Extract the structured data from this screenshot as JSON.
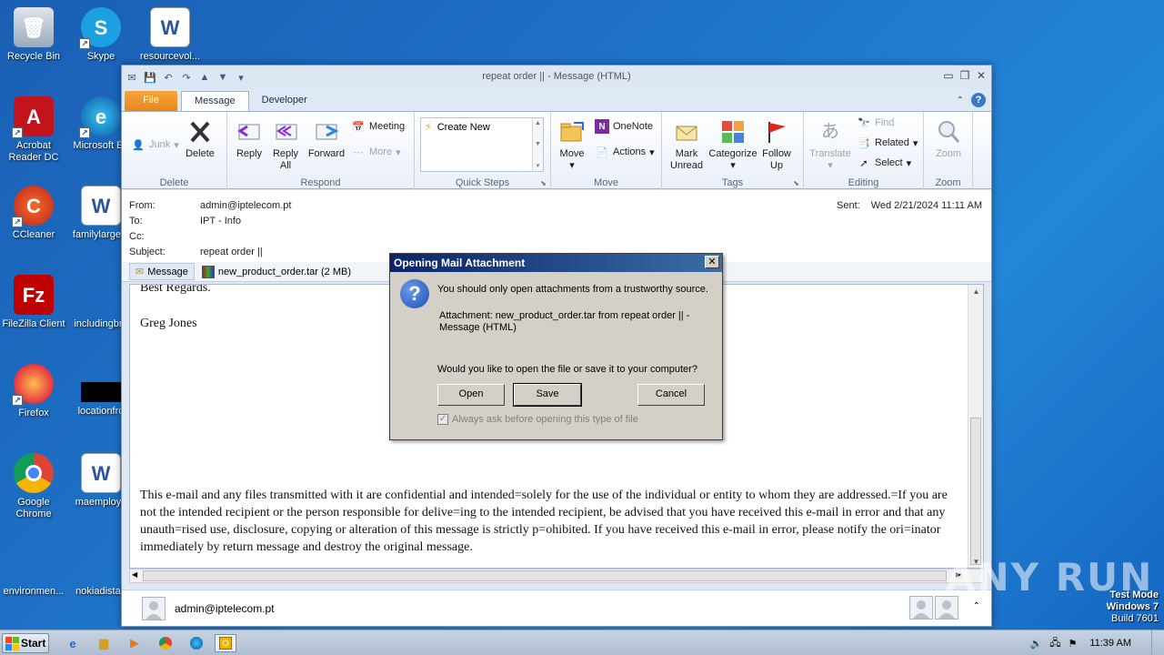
{
  "desktop": {
    "icons": [
      {
        "label": "Recycle Bin"
      },
      {
        "label": "Skype"
      },
      {
        "label": "resourcevol..."
      },
      {
        "label": "Acrobat Reader DC"
      },
      {
        "label": "Microsoft Ed"
      },
      {
        "label": "CCleaner"
      },
      {
        "label": "familylarge..."
      },
      {
        "label": "FileZilla Client"
      },
      {
        "label": "includingbro"
      },
      {
        "label": "Firefox"
      },
      {
        "label": "locationfro"
      },
      {
        "label": "Google Chrome"
      },
      {
        "label": "maemploye"
      },
      {
        "label": "environmen..."
      },
      {
        "label": "nokiadistan"
      }
    ]
  },
  "window": {
    "title": "repeat order ||   -  Message (HTML)",
    "tabs": [
      "File",
      "Message",
      "Developer"
    ]
  },
  "ribbon": {
    "delete_group": {
      "label": "Delete",
      "junk": "Junk",
      "delete": "Delete"
    },
    "respond_group": {
      "label": "Respond",
      "reply": "Reply",
      "reply_all": "Reply All",
      "forward": "Forward",
      "meeting": "Meeting",
      "more": "More"
    },
    "quick_steps": {
      "label": "Quick Steps",
      "create_new": "Create New"
    },
    "move_group": {
      "label": "Move",
      "move": "Move",
      "onenote": "OneNote",
      "actions": "Actions"
    },
    "tags_group": {
      "label": "Tags",
      "mark_unread": "Mark Unread",
      "categorize": "Categorize",
      "follow_up": "Follow Up"
    },
    "editing_group": {
      "label": "Editing",
      "translate": "Translate",
      "find": "Find",
      "related": "Related",
      "select": "Select"
    },
    "zoom_group": {
      "label": "Zoom",
      "zoom": "Zoom"
    }
  },
  "header": {
    "from_label": "From:",
    "from": "admin@iptelecom.pt",
    "to_label": "To:",
    "to": "IPT - Info",
    "cc_label": "Cc:",
    "cc": "",
    "subject_label": "Subject:",
    "subject": "repeat order ||",
    "sent_label": "Sent:",
    "sent": "Wed 2/21/2024 11:11 AM"
  },
  "attachments": {
    "message_tab": "Message",
    "file": "new_product_order.tar (2 MB)"
  },
  "body": {
    "closing": "Best Regards.",
    "signature": "Greg Jones",
    "disclaimer": "This e-mail and any files transmitted with it are confidential and intended=solely for the use of the individual or entity to whom they are addressed.=If you are not the intended recipient or the person responsible for delive=ing to the intended recipient, be advised that you have received this e-mail in error and that any unauth=rised use, disclosure, copying or alteration of this message is strictly p=ohibited. If you have received this e-mail in error, please notify the ori=inator immediately by return message and destroy the original message."
  },
  "people_pane": {
    "sender": "admin@iptelecom.pt"
  },
  "dialog": {
    "title": "Opening Mail Attachment",
    "warning": "You should only open attachments from a trustworthy source.",
    "attachment_line1": "Attachment: new_product_order.tar from repeat order ||   -",
    "attachment_line2": "Message (HTML)",
    "question": "Would you like to open the file or save it to your computer?",
    "open": "Open",
    "save": "Save",
    "cancel": "Cancel",
    "checkbox": "Always ask before opening this type of file",
    "checkbox_checked": true
  },
  "taskbar": {
    "start": "Start",
    "clock": "11:39 AM"
  },
  "watermark": {
    "line1": "Test Mode",
    "line2": "Windows 7",
    "line3": "Build 7601",
    "brand": "ANY RUN"
  },
  "colors": {
    "file_tab": "#e7891b",
    "dialog_title": "#0a246a",
    "desktop": "#1e73c8"
  }
}
